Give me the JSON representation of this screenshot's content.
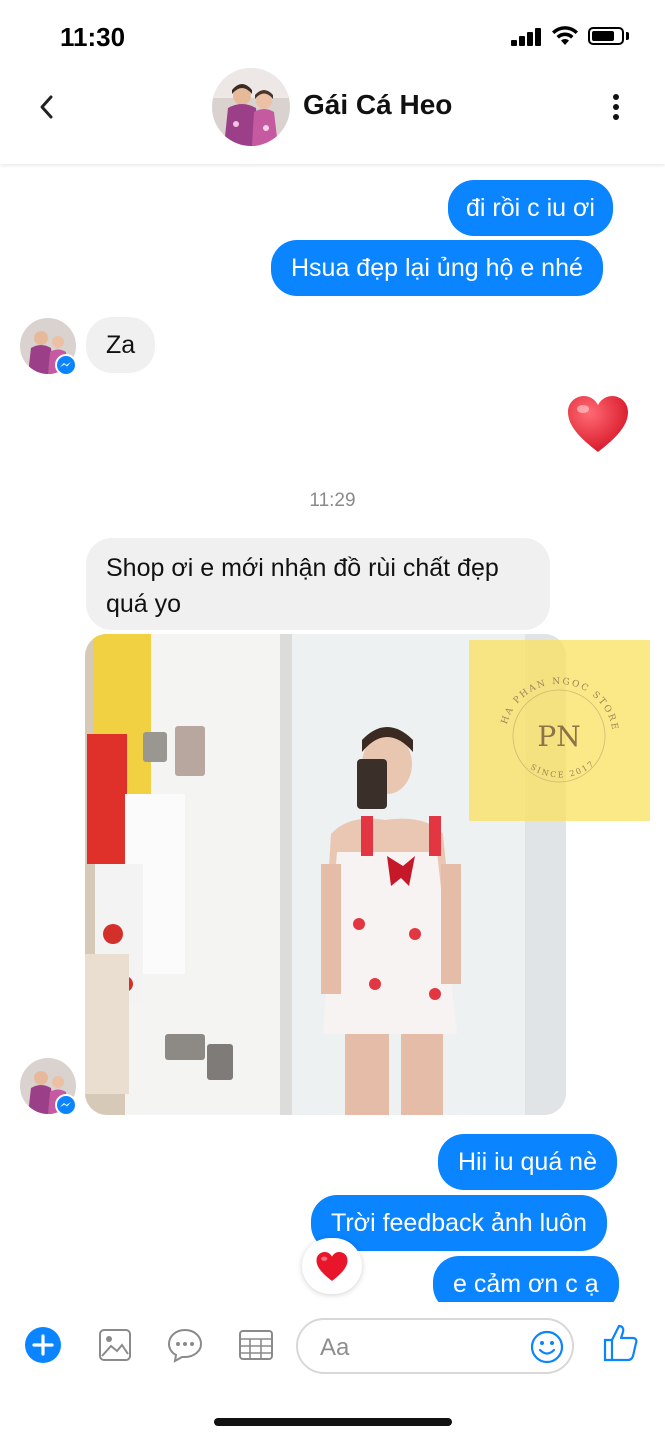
{
  "status": {
    "time": "11:30"
  },
  "header": {
    "contact_name": "Gái Cá Heo"
  },
  "messages": {
    "out1": "đi rồi c iu ơi",
    "out2": "Hsua đẹp lại ủng hộ e nhé",
    "in1": "Za",
    "timestamp": "11:29",
    "in2_line1": "Shop ơi e mới nhận đồ rùi chất đẹp",
    "in2_line2": "quá yo",
    "out3": "Hii iu quá nè",
    "out4": "Trời feedback ảnh luôn",
    "out5": "e cảm ơn c ạ"
  },
  "watermark": {
    "arc_text": "HA PHAN NGOC STORE",
    "monogram": "PN",
    "since": "SINCE 2017"
  },
  "composer": {
    "placeholder": "Aa"
  },
  "colors": {
    "accent": "#0a84ff",
    "incoming_bubble": "#f0f0f0",
    "heart": "#e8152b"
  },
  "icons": [
    "chevron-left-icon",
    "more-vertical-icon",
    "plus-icon",
    "image-icon",
    "chat-bubble-icon",
    "table-icon",
    "smile-icon",
    "thumbs-up-icon",
    "heart-icon",
    "messenger-icon"
  ]
}
